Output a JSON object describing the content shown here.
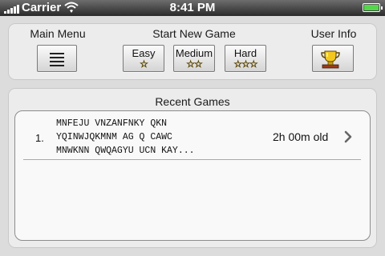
{
  "status_bar": {
    "carrier": "Carrier",
    "time": "8:41 PM",
    "icons": [
      "signal-icon",
      "wifi-icon",
      "battery-icon"
    ],
    "battery_color": "#53d84a"
  },
  "main_menu": {
    "label": "Main Menu",
    "icon": "menu-lines-icon"
  },
  "start_new_game": {
    "label": "Start New Game",
    "difficulties": [
      {
        "label": "Easy",
        "stars": "☆"
      },
      {
        "label": "Medium",
        "stars": "☆☆"
      },
      {
        "label": "Hard",
        "stars": "☆☆☆"
      }
    ],
    "star_color": "#e8c11c"
  },
  "user_info": {
    "label": "User Info",
    "icon": "trophy-icon"
  },
  "recent_games": {
    "title": "Recent Games",
    "items": [
      {
        "index": "1.",
        "lines": [
          "MNFEJU VNZANFNKY QKN",
          "YQINWJQKMNM AG Q CAWC",
          "MNWKNN QWQAGYU UCN KAY..."
        ],
        "age": "2h 00m old"
      }
    ]
  }
}
